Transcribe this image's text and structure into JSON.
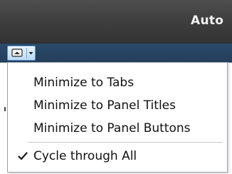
{
  "window": {
    "title": "Auto"
  },
  "toolbar": {
    "panel_button_icon": "panel-minimize-icon",
    "dropdown_icon": "chevron-down-icon"
  },
  "menu": {
    "items": [
      {
        "label": "Minimize to Tabs",
        "checked": false
      },
      {
        "label": "Minimize to Panel Titles",
        "checked": false
      },
      {
        "label": "Minimize to Panel Buttons",
        "checked": false
      },
      {
        "label": "Cycle through All",
        "checked": true
      }
    ],
    "check_icon": "checkmark-icon"
  },
  "colors": {
    "titlebar": "#3f3f3f",
    "ribbon": "#2c4a6b",
    "button_highlight": "#bcd9f5",
    "menu_border": "#9aa0a6"
  }
}
